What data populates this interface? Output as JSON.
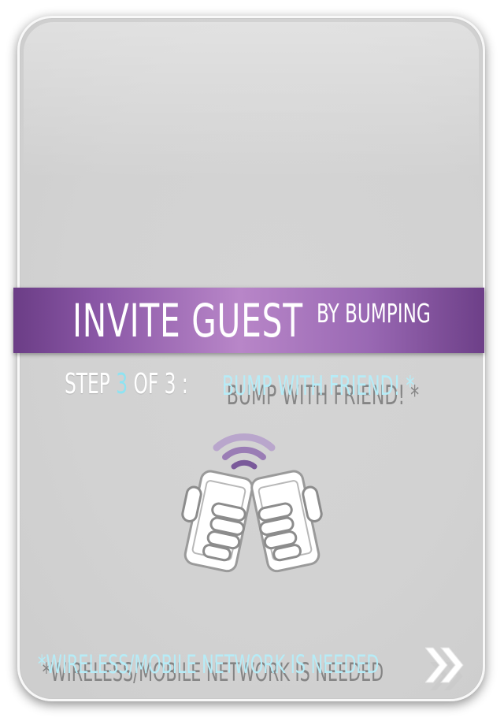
{
  "banner": {
    "title": "INVITE GUEST",
    "subtitle": "BY BUMPING"
  },
  "step": {
    "prefix": "STEP ",
    "current": "3",
    "middle": " OF 3 :",
    "action": "BUMP WITH FRIEND! *"
  },
  "note": "*WIRELESS/MOBILE NETWORK IS NEEDED",
  "icons": {
    "illustration": "phones-bump-icon",
    "next": "double-chevron-right-icon"
  },
  "colors": {
    "banner_purple": "#8a57a6",
    "accent_cyan": "#8ee3f2",
    "card_gray": "#d2d2d2"
  }
}
